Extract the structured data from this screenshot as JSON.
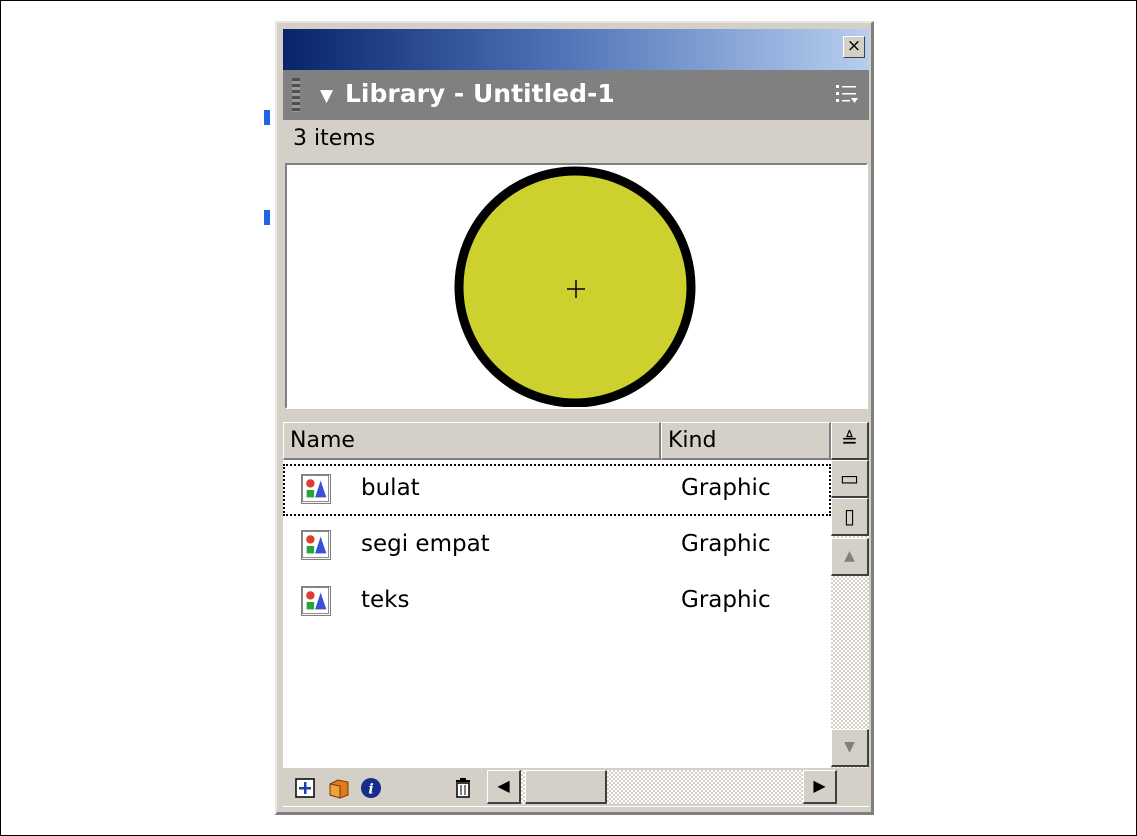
{
  "library": {
    "title": "Library - Untitled-1",
    "item_count": "3 items",
    "close_glyph": "×",
    "collapse_icon": "triangle-down-icon",
    "options_icon": "options-menu-icon"
  },
  "columns": {
    "name": "Name",
    "kind": "Kind"
  },
  "items": [
    {
      "name": "bulat",
      "kind": "Graphic",
      "selected": true
    },
    {
      "name": "segi empat",
      "kind": "Graphic",
      "selected": false
    },
    {
      "name": "teks",
      "kind": "Graphic",
      "selected": false
    }
  ],
  "preview": {
    "shape": "circle",
    "fill": "#cdd12e",
    "stroke": "#000000",
    "registration_mark": "+"
  },
  "side_buttons": {
    "sort_glyph": "≜",
    "wide_glyph": "▭",
    "narrow_glyph": "▯"
  },
  "bottom_icons": [
    "new-symbol-icon",
    "new-folder-icon",
    "properties-icon",
    "delete-icon"
  ],
  "colors": {
    "title_gradient_start": "#08246b",
    "title_gradient_end": "#b7ceef",
    "header_bg": "#808080"
  }
}
